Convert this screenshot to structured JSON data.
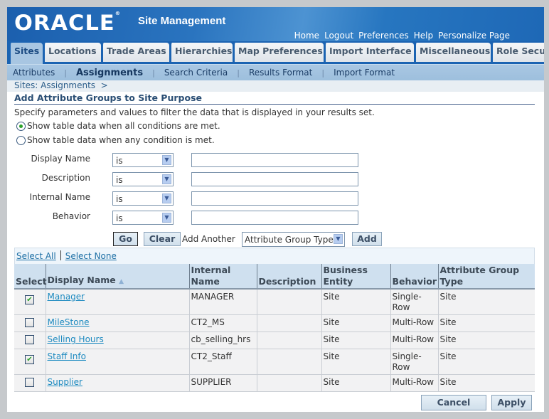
{
  "header": {
    "logo": "ORACLE",
    "app_title": "Site Management",
    "global_links": [
      "Home",
      "Logout",
      "Preferences",
      "Help",
      "Personalize Page"
    ]
  },
  "tabs": [
    {
      "label": "Sites",
      "active": true
    },
    {
      "label": "Locations",
      "active": false
    },
    {
      "label": "Trade Areas",
      "active": false
    },
    {
      "label": "Hierarchies",
      "active": false
    },
    {
      "label": "Map Preferences",
      "active": false
    },
    {
      "label": "Import Interface",
      "active": false
    },
    {
      "label": "Miscellaneous",
      "active": false
    },
    {
      "label": "Role Secu",
      "active": false
    }
  ],
  "subtabs": [
    {
      "label": "Attributes",
      "active": false
    },
    {
      "label": "Assignments",
      "active": true
    },
    {
      "label": "Search Criteria",
      "active": false
    },
    {
      "label": "Results Format",
      "active": false
    },
    {
      "label": "Import Format",
      "active": false
    }
  ],
  "breadcrumb": "Sites: Assignments  >",
  "page": {
    "title": "Add Attribute Groups to Site Purpose",
    "instructions": "Specify parameters and values to filter the data that is displayed in your results set.",
    "match_options": [
      {
        "label": "Show table data when all conditions are met.",
        "selected": true
      },
      {
        "label": "Show table data when any condition is met.",
        "selected": false
      }
    ]
  },
  "filters": [
    {
      "label": "Display Name",
      "operator": "is",
      "value": ""
    },
    {
      "label": "Description",
      "operator": "is",
      "value": ""
    },
    {
      "label": "Internal Name",
      "operator": "is",
      "value": ""
    },
    {
      "label": "Behavior",
      "operator": "is",
      "value": ""
    }
  ],
  "filter_actions": {
    "go": "Go",
    "clear": "Clear",
    "add_another_label": "Add Another",
    "add_another_select": "Attribute Group Type",
    "add": "Add"
  },
  "selection": {
    "select_all": "Select All",
    "select_none": "Select None"
  },
  "table": {
    "columns": [
      "Select",
      "Display Name",
      "Internal Name",
      "Description",
      "Business Entity",
      "Behavior",
      "Attribute Group Type"
    ],
    "sort_indicator": "▲",
    "rows": [
      {
        "selected": true,
        "display_name": "Manager",
        "internal_name": "MANAGER",
        "description": "",
        "business_entity": "Site",
        "behavior": "Single-Row",
        "group_type": "Site"
      },
      {
        "selected": false,
        "display_name": "MileStone",
        "internal_name": "CT2_MS",
        "description": "",
        "business_entity": "Site",
        "behavior": "Multi-Row",
        "group_type": "Site"
      },
      {
        "selected": false,
        "display_name": "Selling Hours",
        "internal_name": "cb_selling_hrs",
        "description": "",
        "business_entity": "Site",
        "behavior": "Multi-Row",
        "group_type": "Site"
      },
      {
        "selected": true,
        "display_name": "Staff Info",
        "internal_name": "CT2_Staff",
        "description": "",
        "business_entity": "Site",
        "behavior": "Single-Row",
        "group_type": "Site"
      },
      {
        "selected": false,
        "display_name": "Supplier",
        "internal_name": "SUPPLIER",
        "description": "",
        "business_entity": "Site",
        "behavior": "Multi-Row",
        "group_type": "Site"
      }
    ]
  },
  "footer": {
    "cancel": "Cancel",
    "apply": "Apply"
  }
}
